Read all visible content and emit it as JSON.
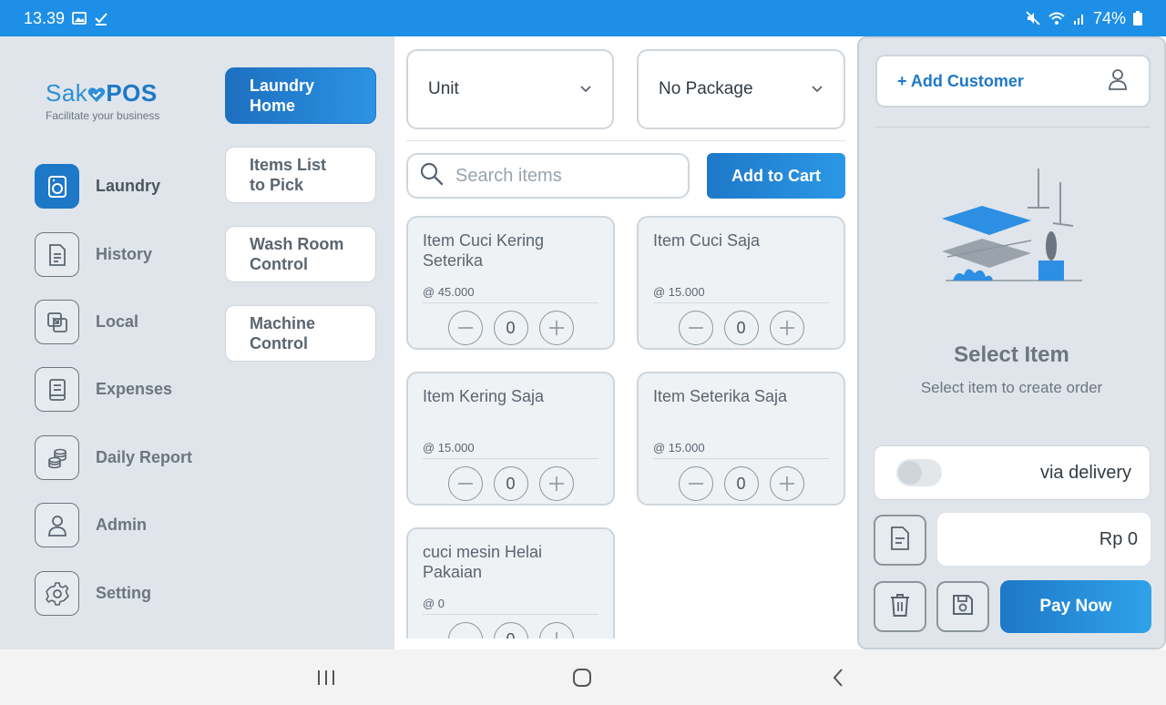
{
  "status_bar": {
    "time": "13.39",
    "battery": "74%"
  },
  "app": {
    "logo_light": "Sak",
    "logo_bold": "POS",
    "tagline": "Facilitate your business"
  },
  "nav": {
    "items": [
      {
        "label": "Laundry",
        "icon": "washing-machine-icon",
        "active": true
      },
      {
        "label": "History",
        "icon": "document-icon",
        "active": false
      },
      {
        "label": "Local",
        "icon": "local-icon",
        "active": false
      },
      {
        "label": "Expenses",
        "icon": "book-icon",
        "active": false
      },
      {
        "label": "Daily Report",
        "icon": "coins-icon",
        "active": false
      },
      {
        "label": "Admin",
        "icon": "user-icon",
        "active": false
      },
      {
        "label": "Setting",
        "icon": "gear-icon",
        "active": false
      }
    ]
  },
  "subnav": {
    "items": [
      {
        "line1": "Laundry",
        "line2": "Home",
        "active": true
      },
      {
        "line1": "Items List",
        "line2": "to Pick",
        "active": false
      },
      {
        "line1": "Wash Room",
        "line2": "Control",
        "active": false
      },
      {
        "line1": "Machine",
        "line2": "Control",
        "active": false
      }
    ]
  },
  "filters": {
    "unit_value": "Unit",
    "package_value": "No Package"
  },
  "search": {
    "placeholder": "Search items"
  },
  "add_to_cart_label": "Add to Cart",
  "items": [
    {
      "name_line1": "Item Cuci Kering",
      "name_line2": "Seterika",
      "price": "@ 45.000",
      "qty": "0"
    },
    {
      "name_line1": "Item Cuci Saja",
      "name_line2": "",
      "price": "@ 15.000",
      "qty": "0"
    },
    {
      "name_line1": "Item Kering Saja",
      "name_line2": "",
      "price": "@ 15.000",
      "qty": "0"
    },
    {
      "name_line1": "Item Seterika Saja",
      "name_line2": "",
      "price": "@ 15.000",
      "qty": "0"
    },
    {
      "name_line1": "cuci mesin Helai",
      "name_line2": "Pakaian",
      "price": "@ 0",
      "qty": "0"
    }
  ],
  "cart": {
    "add_customer_label": "+ Add Customer",
    "empty_title": "Select Item",
    "empty_subtitle": "Select item to create order",
    "delivery_label": "via delivery",
    "delivery_enabled": false,
    "total": "Rp 0",
    "pay_label": "Pay Now"
  },
  "colors": {
    "accent": "#1e78c8",
    "status_bar": "#1e8fe6",
    "panel_bg": "#dfe5ea"
  }
}
